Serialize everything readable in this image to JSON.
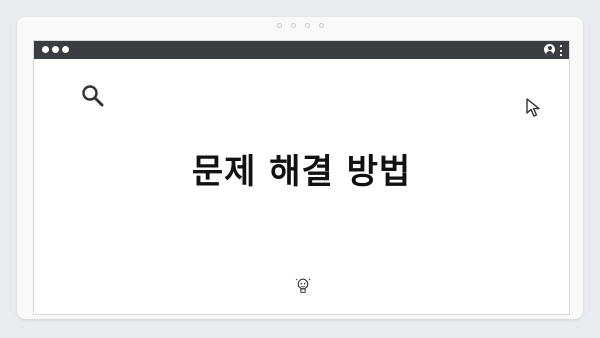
{
  "page": {
    "heading": "문제 해결 방법"
  },
  "pager": {
    "dot_count": 4
  },
  "icons": {
    "search": "search-icon",
    "cursor": "cursor-arrow-icon",
    "bulb": "lightbulb-icon",
    "user": "user-icon",
    "menu": "kebab-menu-icon"
  },
  "colors": {
    "titlebar": "#3a3d42",
    "background": "#e9edf1",
    "window": "#ffffff",
    "text": "#111111"
  }
}
